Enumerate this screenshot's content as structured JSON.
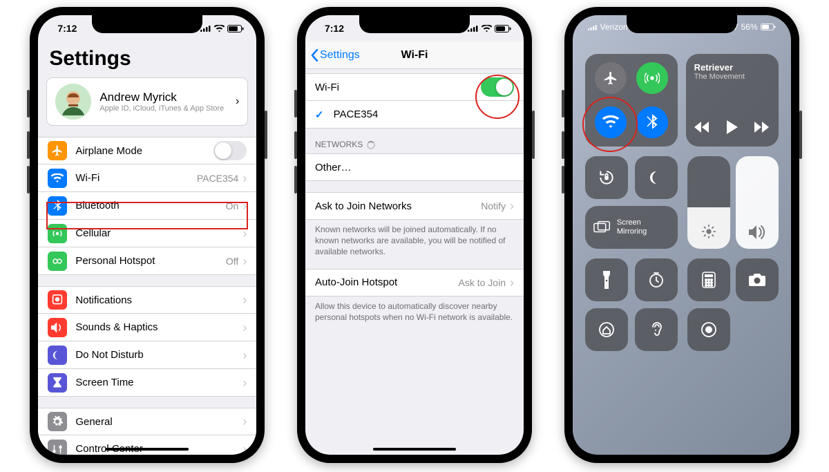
{
  "status": {
    "time": "7:12"
  },
  "settings": {
    "title": "Settings",
    "profile": {
      "name": "Andrew Myrick",
      "sub": "Apple ID, iCloud, iTunes & App Store"
    },
    "group1": [
      {
        "icon": "airplane-icon",
        "bg": "bg-orange",
        "label": "Airplane Mode",
        "value": "",
        "type": "switch",
        "on": false
      },
      {
        "icon": "wifi-icon",
        "bg": "bg-blue",
        "label": "Wi-Fi",
        "value": "PACE354",
        "type": "link"
      },
      {
        "icon": "bluetooth-icon",
        "bg": "bg-blue",
        "label": "Bluetooth",
        "value": "On",
        "type": "link"
      },
      {
        "icon": "cellular-icon",
        "bg": "bg-green",
        "label": "Cellular",
        "value": "",
        "type": "link"
      },
      {
        "icon": "hotspot-icon",
        "bg": "bg-green",
        "label": "Personal Hotspot",
        "value": "Off",
        "type": "link"
      }
    ],
    "group2": [
      {
        "icon": "notifications-icon",
        "bg": "bg-red",
        "label": "Notifications"
      },
      {
        "icon": "sounds-icon",
        "bg": "bg-red",
        "label": "Sounds & Haptics"
      },
      {
        "icon": "dnd-icon",
        "bg": "bg-purple",
        "label": "Do Not Disturb"
      },
      {
        "icon": "screentime-icon",
        "bg": "bg-purple",
        "label": "Screen Time"
      }
    ],
    "group3": [
      {
        "icon": "general-icon",
        "bg": "bg-gray",
        "label": "General"
      },
      {
        "icon": "controlcenter-icon",
        "bg": "bg-gray",
        "label": "Control Center"
      }
    ]
  },
  "wifi": {
    "back": "Settings",
    "title": "Wi-Fi",
    "toggle_label": "Wi-Fi",
    "toggle_on": true,
    "connected": "PACE354",
    "networks_header": "NETWORKS",
    "other": "Other…",
    "ask_label": "Ask to Join Networks",
    "ask_value": "Notify",
    "ask_foot": "Known networks will be joined automatically. If no known networks are available, you will be notified of available networks.",
    "auto_label": "Auto-Join Hotspot",
    "auto_value": "Ask to Join",
    "auto_foot": "Allow this device to automatically discover nearby personal hotspots when no Wi-Fi network is available."
  },
  "cc": {
    "carrier": "Verizon",
    "battery": "56%",
    "now_playing": {
      "title": "Retriever",
      "artist": "The Movement"
    },
    "screen_mirroring": "Screen Mirroring"
  }
}
